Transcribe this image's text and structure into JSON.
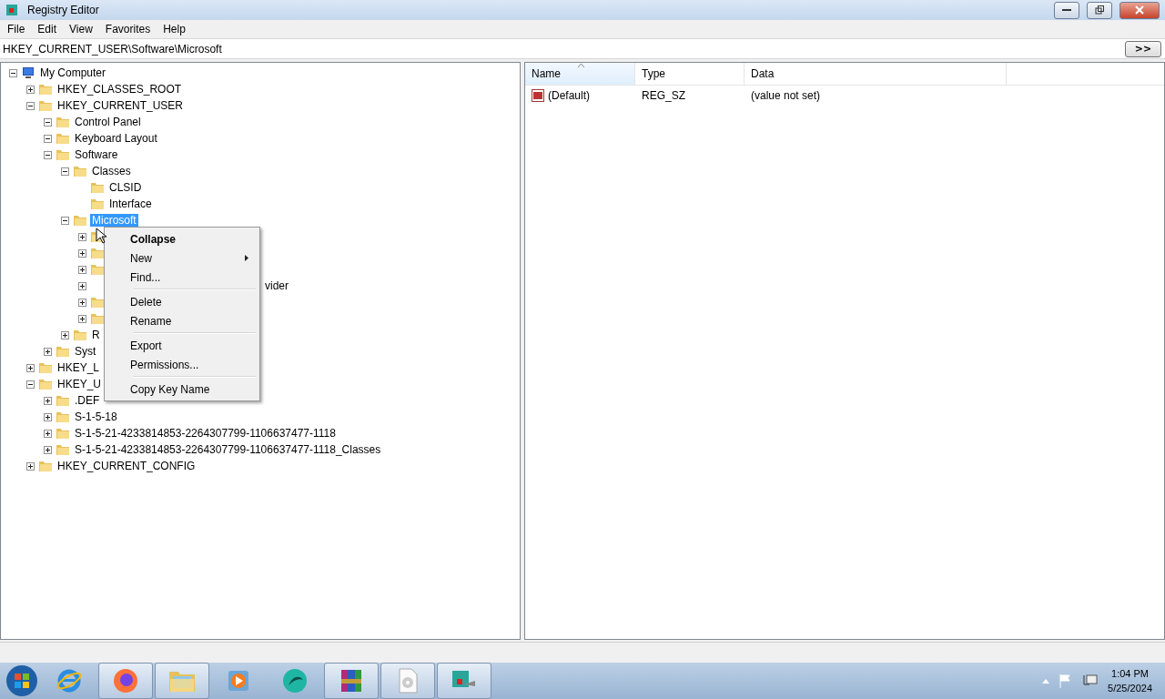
{
  "window": {
    "title": "Registry Editor"
  },
  "menu": [
    "File",
    "Edit",
    "View",
    "Favorites",
    "Help"
  ],
  "address": {
    "value": "HKEY_CURRENT_USER\\Software\\Microsoft",
    "button": ">>"
  },
  "tree": [
    {
      "label": "My Computer",
      "kind": "computer",
      "expanded": true,
      "selected": false,
      "children": [
        {
          "label": "HKEY_CLASSES_ROOT",
          "kind": "folder",
          "expanded": false,
          "selected": false
        },
        {
          "label": "HKEY_CURRENT_USER",
          "kind": "folder",
          "expanded": true,
          "selected": false,
          "children": [
            {
              "label": "Control Panel",
              "kind": "folder",
              "expanded": true,
              "selected": false
            },
            {
              "label": "Keyboard Layout",
              "kind": "folder",
              "expanded": true,
              "selected": false
            },
            {
              "label": "Software",
              "kind": "folder",
              "expanded": true,
              "selected": false,
              "children": [
                {
                  "label": "Classes",
                  "kind": "folder",
                  "expanded": true,
                  "selected": false,
                  "children": [
                    {
                      "label": "CLSID",
                      "kind": "folder",
                      "selected": false
                    },
                    {
                      "label": "Interface",
                      "kind": "folder",
                      "selected": false
                    }
                  ]
                },
                {
                  "label": "Microsoft",
                  "kind": "folder",
                  "expanded": true,
                  "selected": true,
                  "children": [
                    {
                      "kind": "folder",
                      "expanded": false
                    },
                    {
                      "kind": "folder",
                      "expanded": false
                    },
                    {
                      "kind": "folder",
                      "expanded": false
                    },
                    {
                      "label": "vider",
                      "kind": "covered",
                      "expanded": false
                    },
                    {
                      "kind": "folder",
                      "expanded": false
                    },
                    {
                      "kind": "folder",
                      "expanded": false
                    }
                  ]
                },
                {
                  "label": "R",
                  "kind": "folder",
                  "expanded": false,
                  "selected": false
                }
              ]
            },
            {
              "label": "Syst",
              "kind": "folder",
              "expanded": false,
              "selected": false
            }
          ]
        },
        {
          "label": "HKEY_L",
          "kind": "folder",
          "expanded": false,
          "selected": false
        },
        {
          "label": "HKEY_U",
          "kind": "folder",
          "expanded": true,
          "selected": false,
          "children": [
            {
              "label": ".DEF",
              "kind": "folder",
              "expanded": false,
              "selected": false
            },
            {
              "label": "S-1-5-18",
              "kind": "folder",
              "expanded": false,
              "selected": false
            },
            {
              "label": "S-1-5-21-4233814853-2264307799-1106637477-1118",
              "kind": "folder",
              "expanded": false,
              "selected": false
            },
            {
              "label": "S-1-5-21-4233814853-2264307799-1106637477-1118_Classes",
              "kind": "folder",
              "expanded": false,
              "selected": false
            }
          ]
        },
        {
          "label": "HKEY_CURRENT_CONFIG",
          "kind": "folder",
          "expanded": false,
          "selected": false
        }
      ]
    }
  ],
  "context_menu": [
    {
      "label": "Collapse",
      "kind": "default"
    },
    {
      "label": "New",
      "kind": "submenu"
    },
    {
      "label": "Find...",
      "kind": "item"
    },
    {
      "kind": "separator"
    },
    {
      "label": "Delete",
      "kind": "item"
    },
    {
      "label": "Rename",
      "kind": "item"
    },
    {
      "kind": "separator"
    },
    {
      "label": "Export",
      "kind": "item"
    },
    {
      "label": "Permissions...",
      "kind": "item"
    },
    {
      "kind": "separator"
    },
    {
      "label": "Copy Key Name",
      "kind": "item"
    }
  ],
  "values": {
    "columns": [
      {
        "label": "Name",
        "sorted": true
      },
      {
        "label": "Type",
        "sorted": false
      },
      {
        "label": "Data",
        "sorted": false
      }
    ],
    "rows": [
      {
        "name": "(Default)",
        "type": "REG_SZ",
        "data": "(value not set)"
      }
    ]
  },
  "taskbar": {
    "apps": [
      {
        "kind": "ie",
        "active": false
      },
      {
        "kind": "firefox",
        "active": true
      },
      {
        "kind": "explorer",
        "active": true
      },
      {
        "kind": "media",
        "active": false
      },
      {
        "kind": "teal",
        "active": false
      },
      {
        "kind": "archive",
        "active": true
      },
      {
        "kind": "disc",
        "active": true
      },
      {
        "kind": "regedit",
        "active": true
      }
    ],
    "time": "1:04 PM",
    "date": "5/25/2024"
  }
}
